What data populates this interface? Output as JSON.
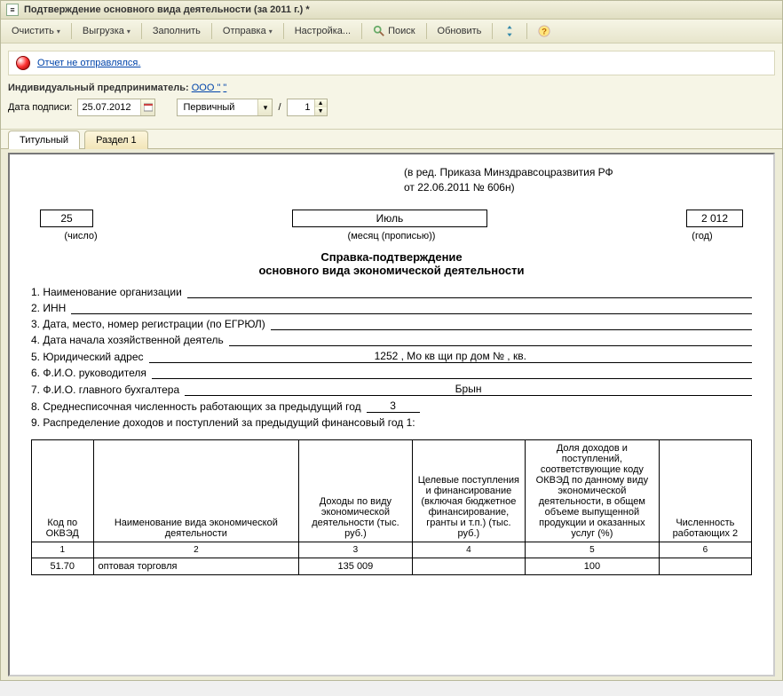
{
  "window": {
    "title": "Подтверждение основного вида деятельности  (за 2011 г.) *"
  },
  "toolbar": {
    "clear": "Очистить",
    "unload": "Выгрузка",
    "fill": "Заполнить",
    "send": "Отправка",
    "settings": "Настройка...",
    "search": "Поиск",
    "refresh": "Обновить"
  },
  "status": {
    "text": "Отчет не отправлялся."
  },
  "org": {
    "label": "Индивидуальный предприниматель:",
    "value": "ООО \""
  },
  "sign_date_label": "Дата подписи:",
  "sign_date_value": "25.07.2012",
  "variant": "Первичный",
  "variant_num": "1",
  "tabs": {
    "t1": "Титульный",
    "t2": "Раздел 1"
  },
  "doc": {
    "note1": "(в ред. Приказа Минздравсоцразвития РФ",
    "note2": "от 22.06.2011 № 606н)",
    "day": "25",
    "month": "Июль",
    "year": "2 012",
    "cap_day": "(число)",
    "cap_month": "(месяц (прописью))",
    "cap_year": "(год)",
    "title": "Справка-подтверждение",
    "subtitle": "основного вида экономической деятельности",
    "f1_lbl": "1. Наименование организации",
    "f1_val": "",
    "f2_lbl": "2. ИНН",
    "f2_val": "",
    "f3_lbl": "3. Дата, место, номер регистрации (по ЕГРЮЛ)",
    "f3_val": "",
    "f4_lbl": "4. Дата начала хозяйственной деятель",
    "f4_val": "",
    "f5_lbl": "5. Юридический адрес",
    "f5_val": "1252  , Мо кв            щи пр         дом №  , кв.",
    "f6_lbl": "6. Ф.И.О. руководителя",
    "f6_val": "",
    "f7_lbl": "7. Ф.И.О. главного бухгалтера",
    "f7_val": "Брын",
    "f8_lbl": "8. Среднесписочная численность работающих за предыдущий год",
    "f8_val": "3",
    "f9_lbl": "9. Распределение доходов и поступлений за предыдущий финансовый год 1:",
    "table": {
      "h1": "Код по ОКВЭД",
      "h2": "Наименование вида экономической деятельности",
      "h3": "Доходы по виду экономической деятельности (тыс. руб.)",
      "h4": "Целевые поступления и финансирование (включая бюджетное финансирование, гранты и т.п.) (тыс. руб.)",
      "h5": "Доля доходов и поступлений, соответствующие коду ОКВЭД по данному виду экономической деятельности, в общем объеме выпущенной продукции и оказанных услуг (%)",
      "h6": "Численность работающих 2",
      "n1": "1",
      "n2": "2",
      "n3": "3",
      "n4": "4",
      "n5": "5",
      "n6": "6",
      "rows": [
        {
          "c1": "51.70",
          "c2": "оптовая торговля",
          "c3": "135 009",
          "c4": "",
          "c5": "100",
          "c6": ""
        }
      ]
    }
  }
}
